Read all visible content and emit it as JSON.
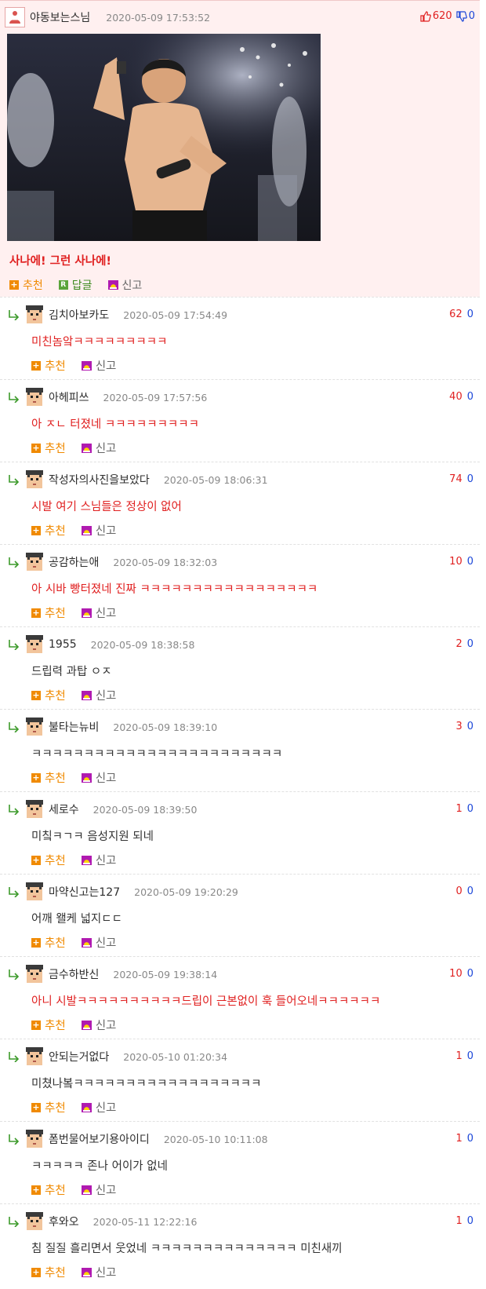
{
  "post": {
    "nickname": "야동보는스님",
    "date": "2020-05-09 17:53:52",
    "upvotes": "620",
    "downvotes": "0",
    "text": "사나에! 그런 사나에!",
    "actions": {
      "recommend": "추천",
      "reply": "답글",
      "report": "신고"
    }
  },
  "actions": {
    "recommend": "추천",
    "report": "신고"
  },
  "comments": [
    {
      "nickname": "김치아보카도",
      "date": "2020-05-09 17:54:49",
      "up": "62",
      "down": "0",
      "text": "미친놈앜ㅋㅋㅋㅋㅋㅋㅋㅋㅋ",
      "color": "#e02020"
    },
    {
      "nickname": "아헤피쓰",
      "date": "2020-05-09 17:57:56",
      "up": "40",
      "down": "0",
      "text": "아 ㅈㄴ 터졌네 ㅋㅋㅋㅋㅋㅋㅋㅋㅋ",
      "color": "#e02020"
    },
    {
      "nickname": "작성자의사진을보았다",
      "date": "2020-05-09 18:06:31",
      "up": "74",
      "down": "0",
      "text": "시발 여기 스님들은 정상이 없어",
      "color": "#e02020"
    },
    {
      "nickname": "공감하는애",
      "date": "2020-05-09 18:32:03",
      "up": "10",
      "down": "0",
      "text": "아 시바 빵터졌네 진짜 ㅋㅋㅋㅋㅋㅋㅋㅋㅋㅋㅋㅋㅋㅋㅋㅋㅋ",
      "color": "#e02020"
    },
    {
      "nickname": "1955",
      "date": "2020-05-09 18:38:58",
      "up": "2",
      "down": "0",
      "text": "드립력 과탑 ㅇㅈ",
      "color": "#333333"
    },
    {
      "nickname": "불타는뉴비",
      "date": "2020-05-09 18:39:10",
      "up": "3",
      "down": "0",
      "text": "ㅋㅋㅋㅋㅋㅋㅋㅋㅋㅋㅋㅋㅋㅋㅋㅋㅋㅋㅋㅋㅋㅋㅋㅋ",
      "color": "#333333"
    },
    {
      "nickname": "세로수",
      "date": "2020-05-09 18:39:50",
      "up": "1",
      "down": "0",
      "text": "미칰ㅋㄱㅋ 음성지원 되네",
      "color": "#333333"
    },
    {
      "nickname": "마약신고는127",
      "date": "2020-05-09 19:20:29",
      "up": "0",
      "down": "0",
      "text": "어깨 왤케 넓지ㄷㄷ",
      "color": "#333333"
    },
    {
      "nickname": "금수하반신",
      "date": "2020-05-09 19:38:14",
      "up": "10",
      "down": "0",
      "text": "아니 시발ㅋㅋㅋㅋㅋㅋㅋㅋㅋㅋ드립이 근본없이 훅 들어오네ㅋㅋㅋㅋㅋㅋ",
      "color": "#e02020"
    },
    {
      "nickname": "안되는거없다",
      "date": "2020-05-10 01:20:34",
      "up": "1",
      "down": "0",
      "text": "미쳤나봌ㅋㅋㅋㅋㅋㅋㅋㅋㅋㅋㅋㅋㅋㅋㅋㅋㅋㅋ",
      "color": "#333333"
    },
    {
      "nickname": "폼번물어보기용아이디",
      "date": "2020-05-10 10:11:08",
      "up": "1",
      "down": "0",
      "text": "ㅋㅋㅋㅋㅋ 존나 어이가 없네",
      "color": "#333333"
    },
    {
      "nickname": "후와오",
      "date": "2020-05-11 12:22:16",
      "up": "1",
      "down": "0",
      "text": "침 질질 흘리면서 웃었네 ㅋㅋㅋㅋㅋㅋㅋㅋㅋㅋㅋㅋㅋㅋ 미친새끼",
      "color": "#333333"
    }
  ]
}
